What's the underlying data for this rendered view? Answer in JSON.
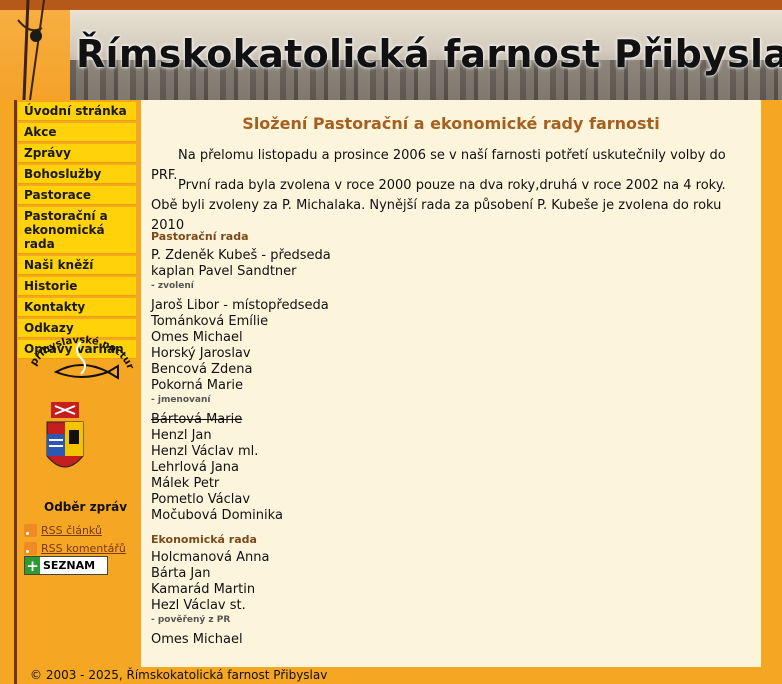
{
  "header": {
    "title": "Římskokatolická farnost Přibyslav"
  },
  "nav": [
    "Úvodní stránka",
    "Akce",
    "Zprávy",
    "Bohoslužby",
    "Pastorace",
    "Pastorační a ekonomická rada",
    "Naši kněží",
    "Historie",
    "Kontakty",
    "Odkazy",
    "Opravy varhan"
  ],
  "logo": {
    "text": "přibyslavské nocturno"
  },
  "feeds": {
    "title": "Odběr zpráv",
    "articles": "RSS článků",
    "comments": "RSS komentářů",
    "seznam": "SEZNAM"
  },
  "main": {
    "heading": "Složení Pastorační a ekonomické rady farnosti",
    "para1": "Na přelomu listopadu a prosince 2006 se v naší farnosti potřetí uskutečnily volby do PRF.",
    "para2": "První rada byla zvolena v roce 2000 pouze na dva roky,druhá v roce 2002 na 4 roky. Obě byli zvoleny za P. Michalaka. Nynější rada za působení P. Kubeše je zvolena do roku 2010",
    "pastoral_heading": "Pastorační rada",
    "pastoral_leaders": [
      "P. Zdeněk Kubeš - předseda",
      "kaplan Pavel Sandtner"
    ],
    "elected_label": "- zvolení",
    "elected": [
      "Jaroš Libor - místopředseda",
      "Tománková Emílie",
      "Omes Michael",
      "Horský Jaroslav",
      "Bencová Zdena",
      "Pokorná Marie"
    ],
    "appointed_label": "- jmenovaní",
    "appointed": [
      "Bártová Marie",
      "Henzl Jan",
      "Henzl Václav ml.",
      "Lehrlová Jana",
      "Málek Petr",
      "Pometlo Václav",
      "Močubová Dominika"
    ],
    "economic_heading": "Ekonomická rada",
    "economic": [
      "Holcmanová Anna",
      "Bárta Jan",
      "Kamarád Martin",
      "Hezl Václav st."
    ],
    "delegated_label": "- pověřený z PR",
    "delegated": [
      "Omes Michael"
    ]
  },
  "footer": {
    "text": "© 2003 - 2025, Římskokatolická farnost Přibyslav"
  },
  "colors": {
    "background": "#f5a623",
    "nav": "#ffd20a",
    "content": "#fdf4dc",
    "heading": "#a56020"
  }
}
